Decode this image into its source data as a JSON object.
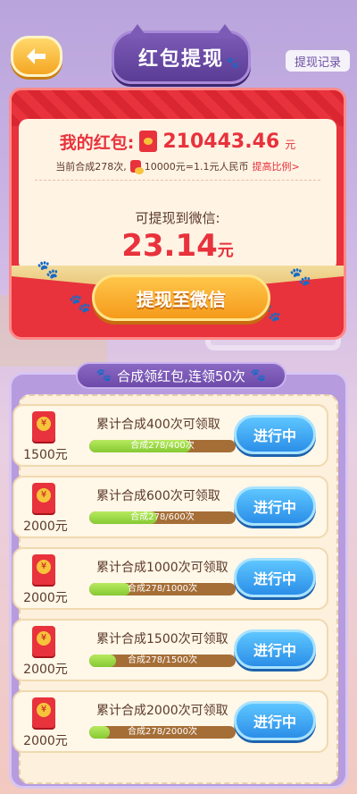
{
  "header": {
    "title": "红包提现",
    "record_label": "提现记录"
  },
  "envelope": {
    "balance_label": "我的红包:",
    "balance_value": "210443.46",
    "balance_unit": "元",
    "rate_prefix": "当前合成278次,",
    "rate_text": "10000元=1.1元人民币",
    "rate_link": "提高比例>",
    "withdraw_label": "可提现到微信:",
    "withdraw_amount": "23.14",
    "withdraw_unit": "元",
    "withdraw_button": "提现至微信"
  },
  "tasks": {
    "title": "合成领红包,连领50次",
    "items": [
      {
        "reward": "1500元",
        "desc": "累计合成400次可领取",
        "progress_text": "合成278/400次",
        "progress": 0.695,
        "button": "进行中"
      },
      {
        "reward": "2000元",
        "desc": "累计合成600次可领取",
        "progress_text": "合成278/600次",
        "progress": 0.463,
        "button": "进行中"
      },
      {
        "reward": "2000元",
        "desc": "累计合成1000次可领取",
        "progress_text": "合成278/1000次",
        "progress": 0.278,
        "button": "进行中"
      },
      {
        "reward": "2000元",
        "desc": "累计合成1500次可领取",
        "progress_text": "合成278/1500次",
        "progress": 0.185,
        "button": "进行中"
      },
      {
        "reward": "2000元",
        "desc": "累计合成2000次可领取",
        "progress_text": "合成278/2000次",
        "progress": 0.139,
        "button": "进行中"
      }
    ]
  }
}
